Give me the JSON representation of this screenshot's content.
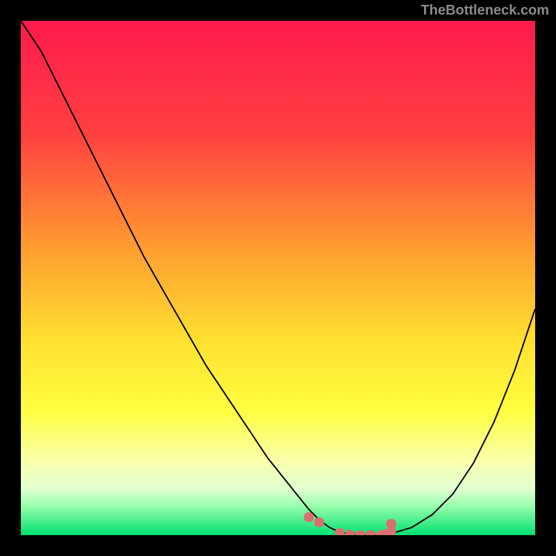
{
  "watermark": "TheBottleneck.com",
  "chart_data": {
    "type": "line",
    "title": "",
    "xlabel": "",
    "ylabel": "",
    "xlim": [
      0,
      100
    ],
    "ylim": [
      0,
      100
    ],
    "x": [
      0,
      4,
      8,
      12,
      16,
      20,
      24,
      28,
      32,
      36,
      40,
      44,
      48,
      52,
      56,
      58,
      60,
      62,
      64,
      66,
      68,
      70,
      72,
      76,
      80,
      84,
      88,
      92,
      96,
      100
    ],
    "values": [
      100,
      94,
      86,
      78,
      70,
      62,
      54,
      47,
      40,
      33,
      27,
      21,
      15,
      10,
      5,
      3,
      1.5,
      0.6,
      0.2,
      0,
      0,
      0,
      0.3,
      1.5,
      4,
      8,
      14,
      22,
      32,
      44
    ],
    "markers": {
      "x": [
        56,
        58,
        62,
        64,
        66,
        68,
        70,
        71,
        72,
        72
      ],
      "y": [
        3.5,
        2.5,
        0.4,
        0.1,
        0,
        0,
        0,
        0.2,
        0.7,
        2.2
      ]
    },
    "gradient_stops": [
      {
        "offset": 0,
        "color": "#ff1a4d"
      },
      {
        "offset": 22,
        "color": "#ff4040"
      },
      {
        "offset": 45,
        "color": "#ffa030"
      },
      {
        "offset": 62,
        "color": "#ffe030"
      },
      {
        "offset": 76,
        "color": "#ffff40"
      },
      {
        "offset": 86,
        "color": "#f8ffb0"
      },
      {
        "offset": 91,
        "color": "#e0ffd0"
      },
      {
        "offset": 94,
        "color": "#a0ffb0"
      },
      {
        "offset": 97,
        "color": "#50f090"
      },
      {
        "offset": 100,
        "color": "#00e070"
      }
    ],
    "marker_color": "#d97070"
  }
}
